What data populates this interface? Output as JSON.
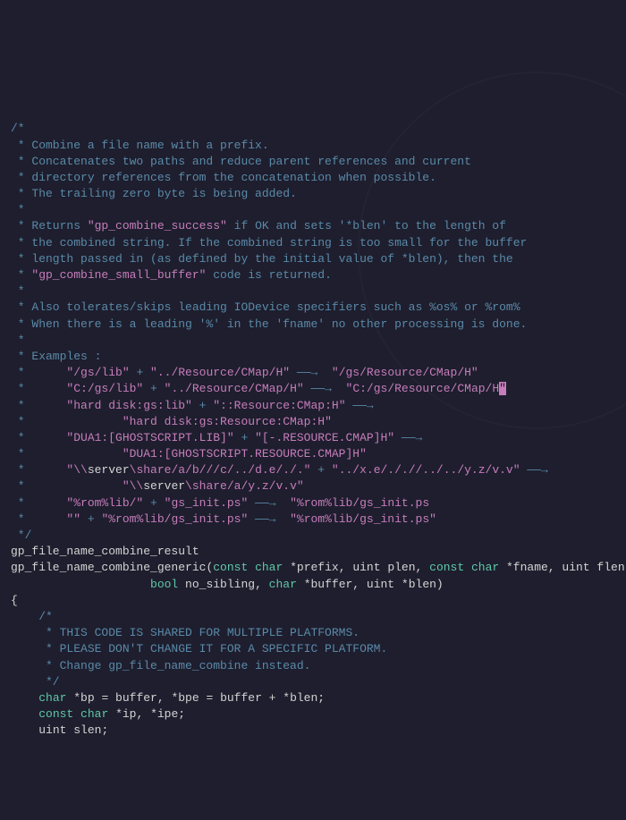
{
  "comment_block": {
    "l1": "/*",
    "l2": " * Combine a file name with a prefix.",
    "l3": " * Concatenates two paths and reduce parent references and current",
    "l4": " * directory references from the concatenation when possible.",
    "l5": " * The trailing zero byte is being added.",
    "l6": " *",
    "l7a": " * Returns ",
    "l7b": "\"gp_combine_success\"",
    "l7c": " if OK and sets '*blen' to the length of",
    "l8": " * the combined string. If the combined string is too small for the buffer",
    "l9": " * length passed in (as defined by the initial value of *blen), then the",
    "l10a": " * ",
    "l10b": "\"gp_combine_small_buffer\"",
    "l10c": " code is returned.",
    "l11": " *",
    "l12": " * Also tolerates/skips leading IODevice specifiers such as %os% or %rom%",
    "l13": " * When there is a leading '%' in the 'fname' no other processing is done.",
    "l14": " *",
    "l15": " * Examples :",
    "l16a": " *      ",
    "l16b": "\"/gs/lib\"",
    "l16c": " + ",
    "l16d": "\"../Resource/CMap/H\"",
    "l16e": " ",
    "l16arrow": "——→",
    "l16f": "  ",
    "l16g": "\"/gs/Resource/CMap/H\"",
    "l17a": " *      ",
    "l17b": "\"C:/gs/lib\"",
    "l17c": " + ",
    "l17d": "\"../Resource/CMap/H\"",
    "l17e": " ",
    "l17arrow": "——→",
    "l17f": "  ",
    "l17g": "\"C:/gs/Resource/CMap/H",
    "l17cursor": "\"",
    "l18a": " *      ",
    "l18b": "\"hard disk:gs:lib\"",
    "l18c": " + ",
    "l18d": "\"::Resource:CMap:H\"",
    "l18e": " ",
    "l18arrow": "——→",
    "l19a": " *              ",
    "l19b": "\"hard disk:gs:Resource:CMap:H\"",
    "l20a": " *      ",
    "l20b": "\"DUA1:[GHOSTSCRIPT.LIB]\"",
    "l20c": " + ",
    "l20d": "\"[-.RESOURCE.CMAP]H\"",
    "l20e": " ",
    "l20arrow": "——→",
    "l21a": " *              ",
    "l21b": "\"DUA1:[GHOSTSCRIPT.RESOURCE.CMAP]H\"",
    "l22a": " *      ",
    "l22b": "\"\\\\",
    "l22c": "server",
    "l22d": "\\s",
    "l22e": "hare/a/b///c/../d.e/./.\"",
    "l22f": " + ",
    "l22g": "\"../x.e/././/../../y.z/v.v\"",
    "l22h": " ",
    "l22arrow": "——→",
    "l23a": " *              ",
    "l23b": "\"\\\\",
    "l23c": "server",
    "l23d": "\\s",
    "l23e": "hare/a/y.z/v.v\"",
    "l24a": " *      ",
    "l24b": "\"%rom%lib/\"",
    "l24c": " + ",
    "l24d": "\"gs_init.ps\"",
    "l24e": " ",
    "l24arrow": "——→",
    "l24f": "  ",
    "l24g": "\"%rom%lib/gs_init.ps",
    "l25a": " *      ",
    "l25b": "\"\"",
    "l25c": " + ",
    "l25d": "\"%rom%lib/gs_init.ps\"",
    "l25e": " ",
    "l25arrow": "——→",
    "l25f": "  ",
    "l25g": "\"%rom%lib/gs_init.ps\"",
    "l26": " */"
  },
  "code": {
    "ret_type": "gp_file_name_combine_result",
    "fn_name": "gp_file_name_combine_generic",
    "kw_const": "const",
    "kw_char": "char",
    "kw_uint": "uint",
    "kw_bool": "bool",
    "p_prefix": " *prefix, ",
    "p_plen": " plen, ",
    "p_fname": " *fname, ",
    "p_flen": " flen,",
    "indent2": "                    ",
    "p_nosib": " no_sibling, ",
    "p_buffer": " *buffer, ",
    "p_blen": " *blen)",
    "brace_open": "{",
    "ic1": "    /*",
    "ic2": "     * THIS CODE IS SHARED FOR MULTIPLE PLATFORMS.",
    "ic3": "     * PLEASE DON'T CHANGE IT FOR A SPECIFIC PLATFORM.",
    "ic4": "     * Change gp_file_name_combine instead.",
    "ic5": "     */",
    "indent": "    ",
    "decl1": " *bp = buffer, *bpe = buffer + *blen;",
    "decl2": " *ip, *ipe;",
    "decl3": " slen;"
  }
}
